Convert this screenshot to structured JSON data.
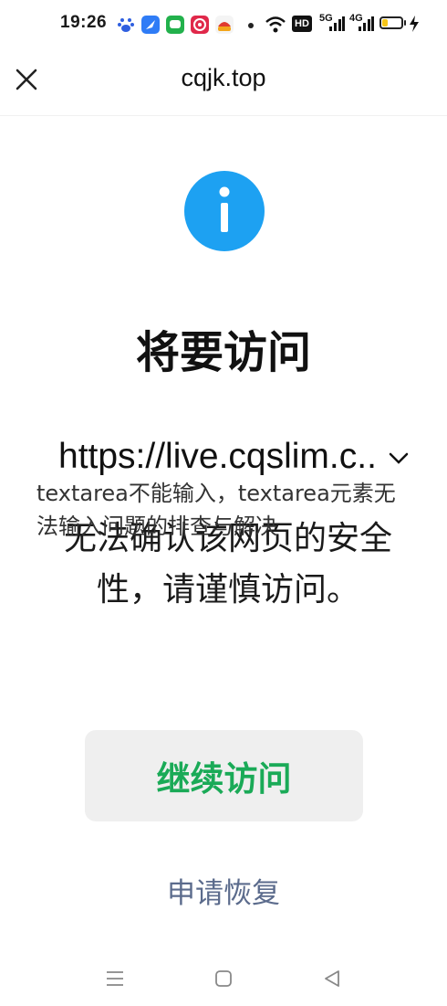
{
  "status_bar": {
    "time": "19:26",
    "network_badge": "HD",
    "signal_1": "5G",
    "signal_2": "4G",
    "battery_level": 0.3,
    "icons": [
      "baidu-icon",
      "feather-app-icon",
      "wechat-icon",
      "target-app-icon",
      "shopping-app-icon",
      "wifi-icon",
      "signal-icon",
      "battery-icon",
      "charging-icon"
    ]
  },
  "header": {
    "title": "cqjk.top",
    "close_icon": "close-icon"
  },
  "main": {
    "heading": "将要访问",
    "url": "https://live.cqslim.c..",
    "warning_line1": "无法确认该网页的安全",
    "warning_line2": "性，请谨慎访问。",
    "overlay_line1": "textarea不能输入，textarea元素无",
    "overlay_line2": "法输入问题的排查与解决",
    "continue_label": "继续访问",
    "appeal_label": "申请恢复"
  },
  "colors": {
    "info_blue": "#1da1f2",
    "continue_green": "#1aaa57",
    "appeal_blue_gray": "#5b6b8c",
    "button_bg": "#efefef"
  },
  "nav": {
    "icons": [
      "menu-icon",
      "home-icon",
      "back-icon"
    ]
  }
}
